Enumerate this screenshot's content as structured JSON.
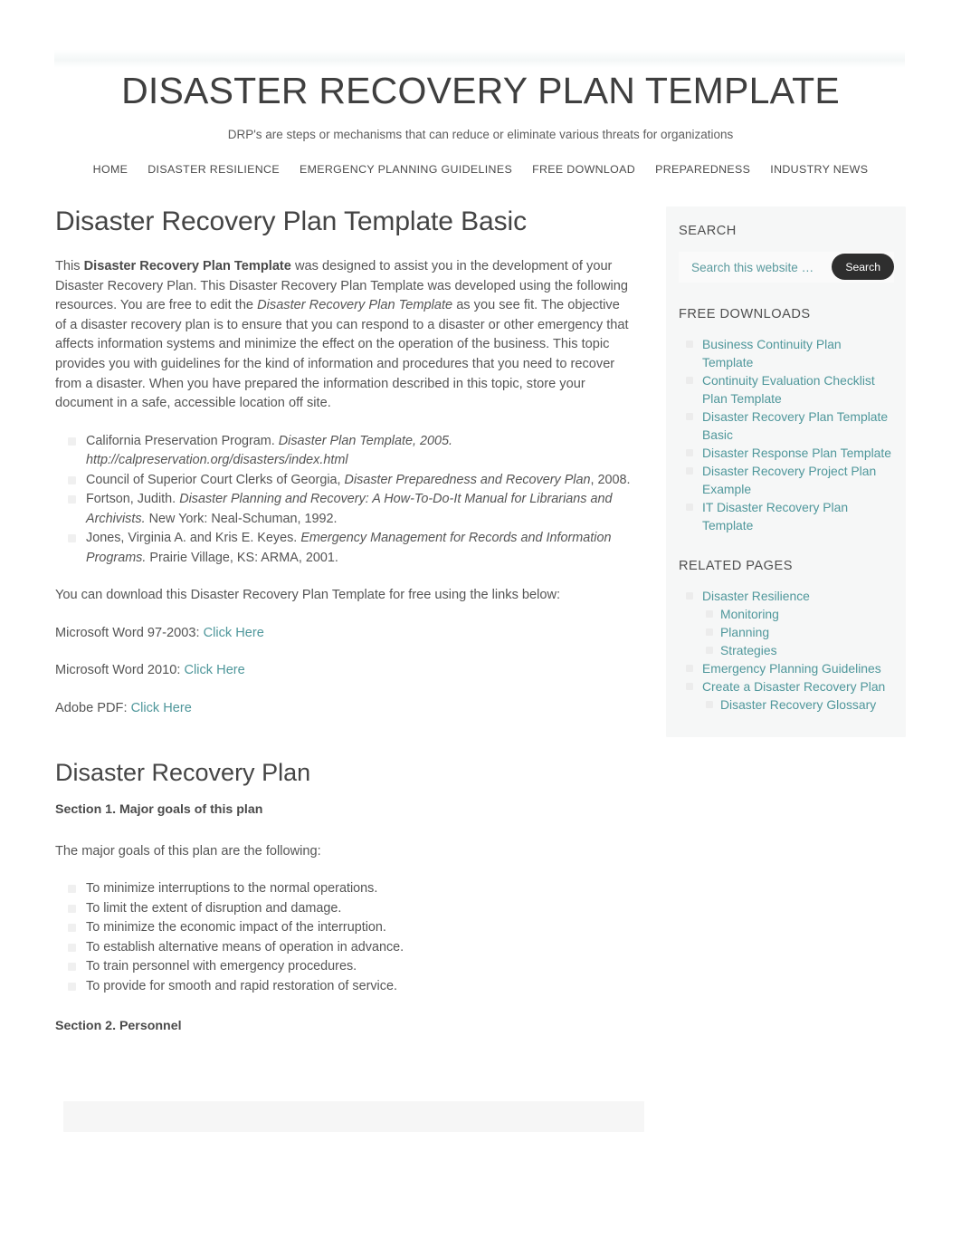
{
  "site": {
    "title": "DISASTER RECOVERY PLAN TEMPLATE",
    "tagline": "DRP's are steps or mechanisms that can reduce or eliminate various threats for organizations"
  },
  "nav": {
    "items": [
      {
        "label": "HOME"
      },
      {
        "label": "DISASTER RESILIENCE"
      },
      {
        "label": "EMERGENCY PLANNING GUIDELINES"
      },
      {
        "label": "FREE DOWNLOAD"
      },
      {
        "label": "PREPAREDNESS"
      },
      {
        "label": "INDUSTRY NEWS"
      }
    ]
  },
  "entry": {
    "title": "Disaster Recovery Plan Template Basic",
    "intro": {
      "p1_a": "This ",
      "p1_b": "Disaster Recovery Plan Template",
      "p1_c": " was designed to assist you in the development of your Disaster Recovery Plan.  This Disaster Recovery Plan Template was developed using the following resources. You are free to edit the ",
      "p1_d": "Disaster Recovery Plan Template",
      "p1_e": " as you see fit. The objective of a disaster recovery plan is to ensure that you can respond to a disaster or other emergency that affects information systems and minimize the effect on the operation of the business. This topic provides you with guidelines for the kind of information and procedures that you need to recover from a disaster. When you have prepared the information described in this topic, store your document in a safe, accessible location off site."
    },
    "references": [
      {
        "plain_a": "California Preservation Program.  ",
        "italic_a": "Disaster Plan Template, 2005. http://calpreservation.org/disasters/index.html",
        "plain_b": ""
      },
      {
        "plain_a": "Council of Superior Court Clerks of Georgia, ",
        "italic_a": "Disaster Preparedness and Recovery Plan",
        "plain_b": ", 2008."
      },
      {
        "plain_a": "Fortson, Judith. ",
        "italic_a": "Disaster Planning and Recovery: A How-To-Do-It Manual for Librarians and Archivists.",
        "plain_b": " New York: Neal-Schuman, 1992."
      },
      {
        "plain_a": "Jones, Virginia A. and Kris E. Keyes.  ",
        "italic_a": "Emergency Management for Records and Information Programs.",
        "plain_b": "  Prairie Village, KS: ARMA, 2001."
      }
    ],
    "download_intro": "You can download this Disaster Recovery Plan Template for free using the links below:",
    "downloads": [
      {
        "label": "Microsoft Word 97-2003: ",
        "link": "Click Here"
      },
      {
        "label": "Microsoft Word 2010: ",
        "link": "Click Here"
      },
      {
        "label": "Adobe PDF:  ",
        "link": "Click Here"
      }
    ],
    "plan_title": "Disaster Recovery Plan",
    "section1_title": "Section 1. Major goals of this plan",
    "section1_lead": "The major goals of this plan are the following:",
    "goals": [
      "To minimize interruptions to the normal operations.",
      "To limit the extent of disruption and damage.",
      "To minimize the economic impact of the interruption.",
      "To establish alternative means of operation in advance.",
      "To train personnel with emergency procedures.",
      "To provide for smooth and rapid restoration of service."
    ],
    "section2_title": "Section 2. Personnel"
  },
  "sidebar": {
    "search": {
      "title": "SEARCH",
      "placeholder": "Search this website …",
      "button": "Search"
    },
    "free_downloads": {
      "title": "FREE DOWNLOADS",
      "items": [
        {
          "label": "Business Continuity Plan Template"
        },
        {
          "label": "Continuity Evaluation Checklist Plan Template"
        },
        {
          "label": "Disaster Recovery Plan Template Basic"
        },
        {
          "label": "Disaster Response Plan Template"
        },
        {
          "label": "Disaster Recovery Project Plan Example"
        },
        {
          "label": "IT Disaster Recovery Plan Template"
        }
      ]
    },
    "related_pages": {
      "title": "RELATED PAGES",
      "items": [
        {
          "label": "Disaster Resilience",
          "children": [
            {
              "label": "Monitoring"
            },
            {
              "label": "Planning"
            },
            {
              "label": "Strategies"
            }
          ]
        },
        {
          "label": "Emergency Planning Guidelines",
          "children": []
        },
        {
          "label": "Create a Disaster Recovery Plan",
          "children": [
            {
              "label": "Disaster Recovery Glossary"
            }
          ]
        }
      ]
    }
  },
  "colors": {
    "link": "#4f979b",
    "heading": "#444444",
    "body_text": "#555555",
    "sidebar_bg": "#f6f7f7",
    "button_bg": "#2e2e2e"
  }
}
